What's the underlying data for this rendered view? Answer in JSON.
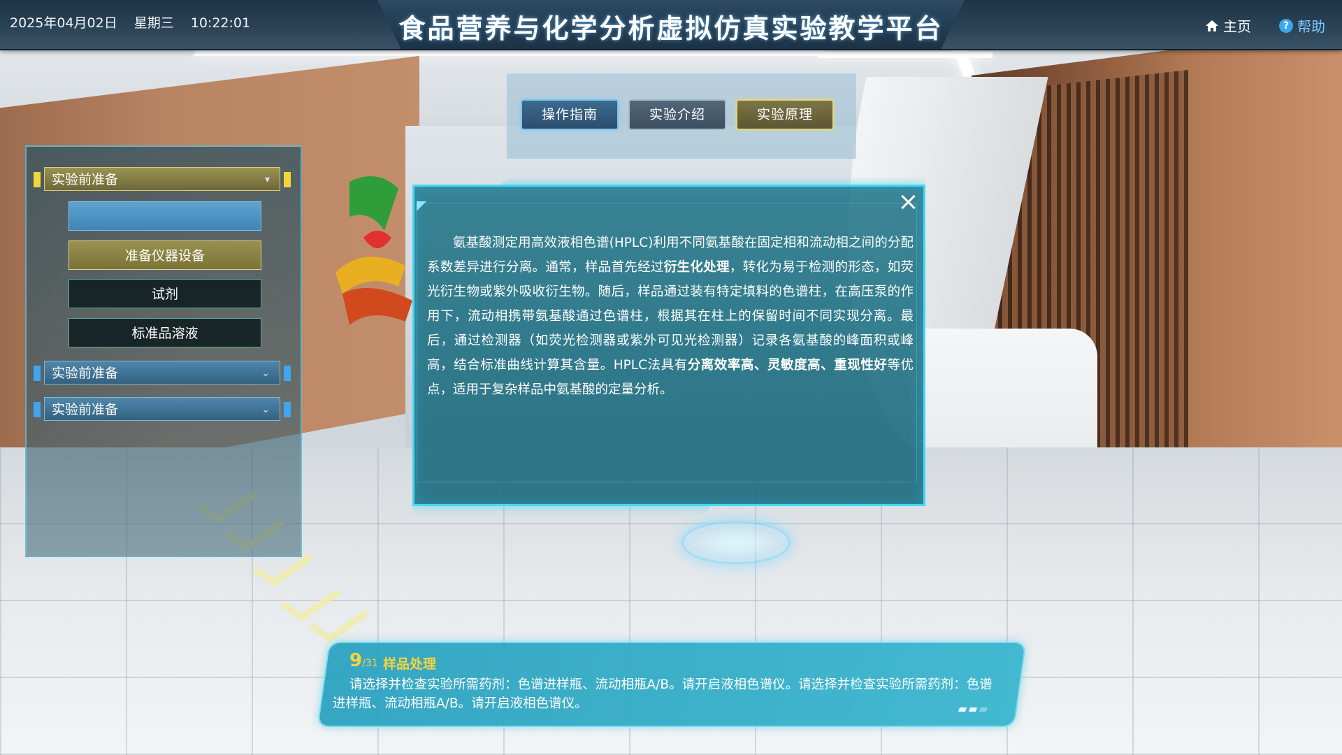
{
  "header": {
    "date": "2025年04月02日",
    "weekday": "星期三",
    "time": "10:22:01",
    "title": "食品营养与化学分析虚拟仿真实验教学平台",
    "home_label": "主页",
    "help_label": "帮助"
  },
  "tabs": [
    {
      "label": "操作指南"
    },
    {
      "label": "实验介绍"
    },
    {
      "label": "实验原理"
    }
  ],
  "sidebar": {
    "groups": [
      {
        "label": "实验前准备",
        "expanded": true,
        "items": [
          {
            "label": ""
          },
          {
            "label": "准备仪器设备"
          },
          {
            "label": "试剂"
          },
          {
            "label": "标准品溶液"
          }
        ]
      },
      {
        "label": "实验前准备",
        "expanded": false
      },
      {
        "label": "实验前准备",
        "expanded": false
      }
    ]
  },
  "dialog": {
    "paragraph": {
      "p1": "氨基酸测定用高效液相色谱(HPLC)利用不同氨基酸在固定相和流动相之间的分配系数差异进行分离。通常，样品首先经过",
      "b1": "衍生化处理",
      "p2": "，转化为易于检测的形态，如荧光衍生物或紫外吸收衍生物。随后，样品通过装有特定填料的色谱柱，在高压泵的作用下，流动相携带氨基酸通过色谱柱，根据其在柱上的保留时间不同实现分离。最后，通过检测器（如荧光检测器或紫外可见光检测器）记录各氨基酸的峰面积或峰高，结合标准曲线计算其含量。HPLC法具有",
      "b2": "分离效率高、灵敏度高、重现性好",
      "p3": "等优点，适用于复杂样品中氨基酸的定量分析。"
    }
  },
  "tip": {
    "step_current": "9",
    "step_total": "31",
    "title": "样品处理",
    "text": "请选择并检查实验所需药剂：色谱进样瓶、流动相瓶A/B。请开启液相色谱仪。请选择并检查实验所需药剂：色谱进样瓶、流动相瓶A/B。请开启液相色谱仪。"
  },
  "colors": {
    "accent_cyan": "#47d7f5",
    "gold": "#f6d43b",
    "header_bg": "#2c4457"
  },
  "icons": {
    "home": "home-icon",
    "help": "help-icon",
    "close": "close-icon",
    "caret": "chevron-down-icon"
  }
}
